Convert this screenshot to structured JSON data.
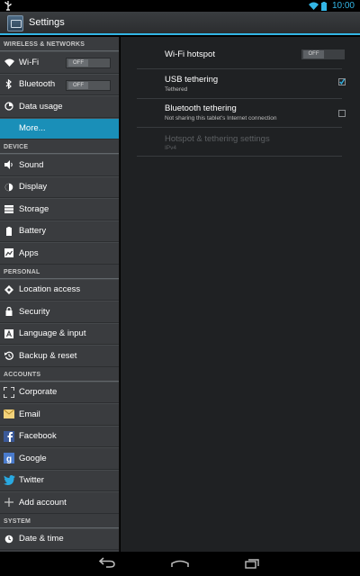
{
  "status_bar": {
    "time": "10:00",
    "accent": "#33b5e5"
  },
  "action_bar": {
    "title": "Settings",
    "icon": "settings-app-icon"
  },
  "sidebar": {
    "sections": [
      {
        "header": "WIRELESS & NETWORKS",
        "items": [
          {
            "label": "Wi-Fi",
            "icon": "wifi-icon",
            "toggle": "OFF"
          },
          {
            "label": "Bluetooth",
            "icon": "bluetooth-icon",
            "toggle": "OFF"
          },
          {
            "label": "Data usage",
            "icon": "data-usage-icon"
          },
          {
            "label": "More...",
            "selected": true
          }
        ]
      },
      {
        "header": "DEVICE",
        "items": [
          {
            "label": "Sound",
            "icon": "sound-icon"
          },
          {
            "label": "Display",
            "icon": "display-icon"
          },
          {
            "label": "Storage",
            "icon": "storage-icon"
          },
          {
            "label": "Battery",
            "icon": "battery-icon"
          },
          {
            "label": "Apps",
            "icon": "apps-icon"
          }
        ]
      },
      {
        "header": "PERSONAL",
        "items": [
          {
            "label": "Location access",
            "icon": "location-icon"
          },
          {
            "label": "Security",
            "icon": "lock-icon"
          },
          {
            "label": "Language & input",
            "icon": "language-icon"
          },
          {
            "label": "Backup & reset",
            "icon": "backup-icon"
          }
        ]
      },
      {
        "header": "ACCOUNTS",
        "items": [
          {
            "label": "Corporate",
            "icon": "corporate-icon"
          },
          {
            "label": "Email",
            "icon": "email-icon"
          },
          {
            "label": "Facebook",
            "icon": "facebook-icon"
          },
          {
            "label": "Google",
            "icon": "google-icon"
          },
          {
            "label": "Twitter",
            "icon": "twitter-icon"
          },
          {
            "label": "Add account",
            "icon": "add-icon"
          }
        ]
      },
      {
        "header": "SYSTEM",
        "items": [
          {
            "label": "Date & time",
            "icon": "clock-icon"
          }
        ]
      }
    ]
  },
  "main": {
    "prefs": [
      {
        "title": "Wi-Fi hotspot",
        "toggle": "OFF"
      },
      {
        "title": "USB tethering",
        "summary": "Tethered",
        "checked": true
      },
      {
        "title": "Bluetooth tethering",
        "summary": "Not sharing this tablet's Internet connection",
        "checked": false
      },
      {
        "title": "Hotspot & tethering settings",
        "summary": "IPv4",
        "disabled": true
      }
    ]
  },
  "nav_bar": {
    "buttons": [
      "back-icon",
      "home-icon",
      "recent-apps-icon"
    ]
  }
}
